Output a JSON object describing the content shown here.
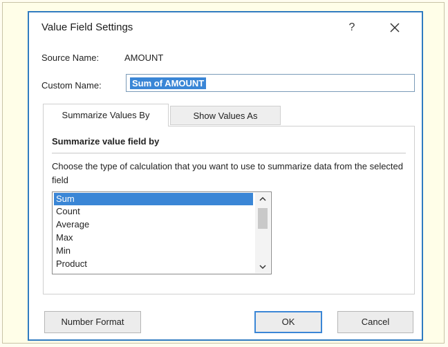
{
  "dialog": {
    "title": "Value Field Settings",
    "help_label": "?",
    "close_icon": "close-icon"
  },
  "fields": {
    "source_label": "Source Name:",
    "source_value": "AMOUNT",
    "custom_label": "Custom Name:",
    "custom_value": "Sum of AMOUNT"
  },
  "tabs": [
    {
      "label": "Summarize Values By",
      "active": true
    },
    {
      "label": "Show Values As",
      "active": false
    }
  ],
  "panel": {
    "section_title": "Summarize value field by",
    "description": "Choose the type of calculation that you want to use to summarize data from the selected field",
    "items": [
      "Sum",
      "Count",
      "Average",
      "Max",
      "Min",
      "Product"
    ],
    "selected": "Sum",
    "scroll_up_icon": "chevron-up-icon",
    "scroll_down_icon": "chevron-down-icon"
  },
  "buttons": {
    "number_format": "Number Format",
    "ok": "OK",
    "cancel": "Cancel"
  },
  "colors": {
    "accent": "#3a86d6",
    "border": "#2f7bc0"
  }
}
